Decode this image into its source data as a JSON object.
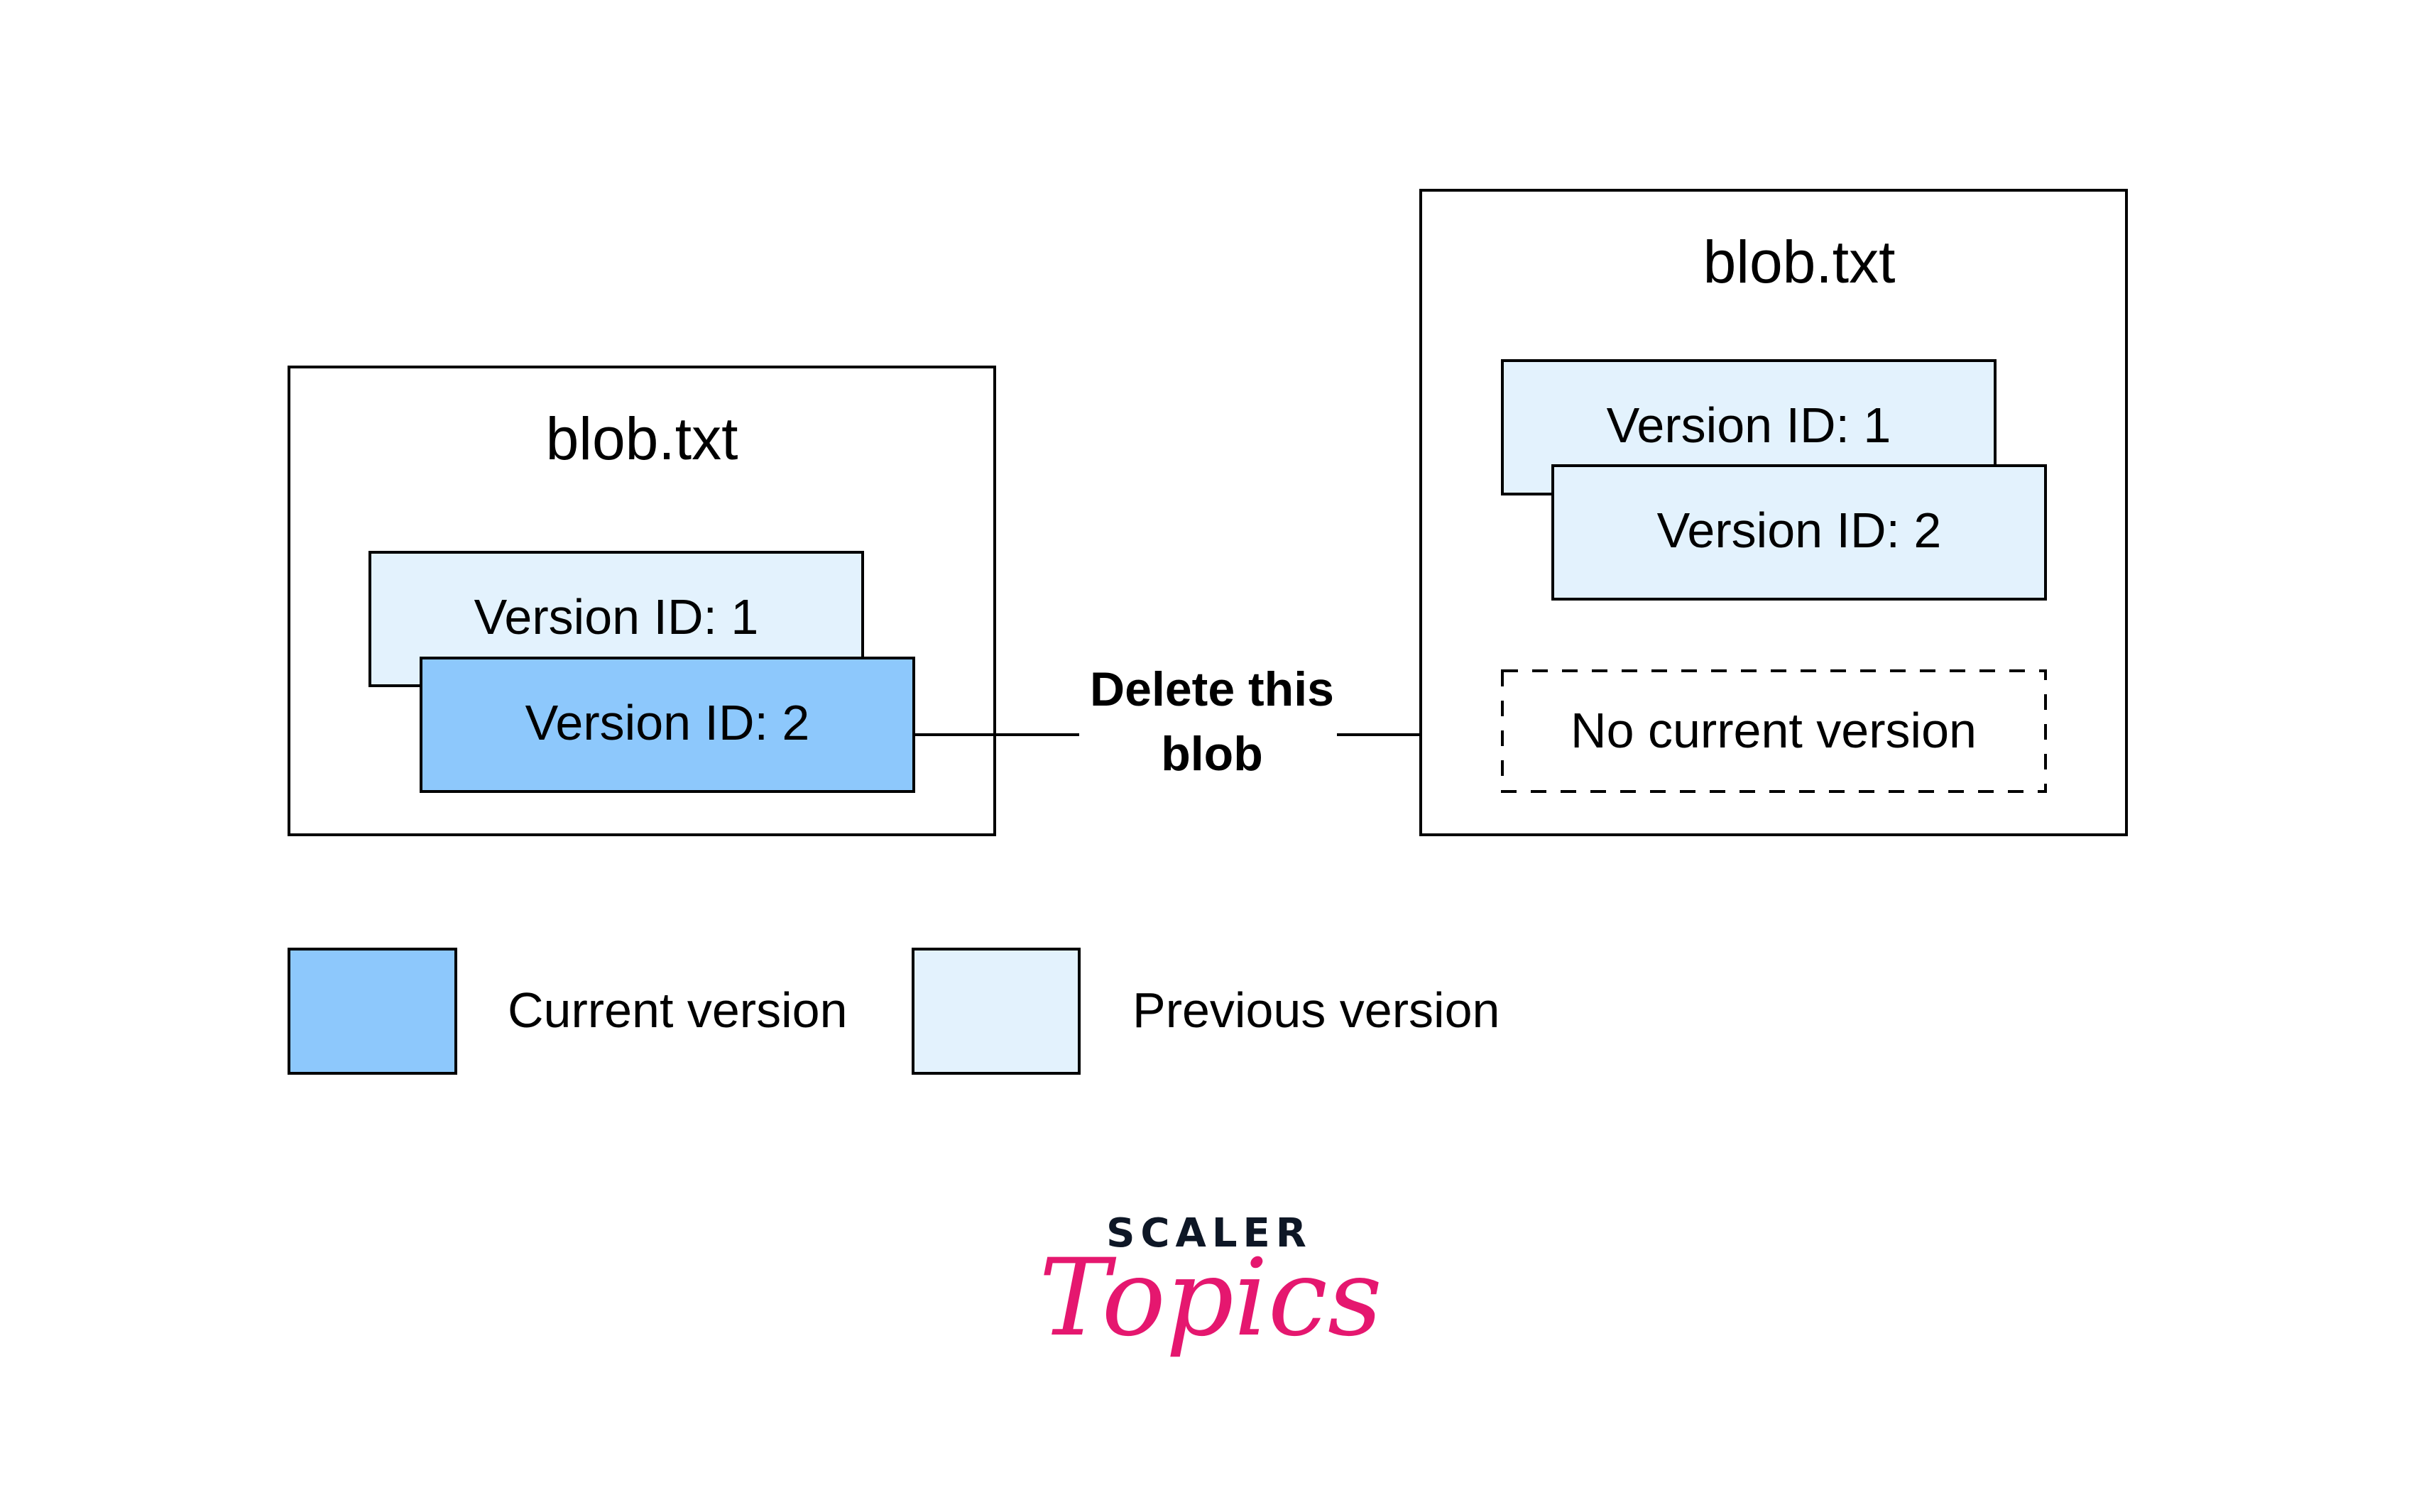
{
  "colors": {
    "current": "#8DC8FC",
    "previous": "#E3F2FD",
    "stroke": "#000000",
    "logo_dark": "#0E1726",
    "logo_pink": "#E5176F"
  },
  "before": {
    "title": "blob.txt",
    "versions": [
      {
        "label": "Version ID: 1",
        "state": "previous"
      },
      {
        "label": "Version ID: 2",
        "state": "current"
      }
    ]
  },
  "action": {
    "line1": "Delete this",
    "line2": "blob"
  },
  "after": {
    "title": "blob.txt",
    "versions": [
      {
        "label": "Version ID: 1",
        "state": "previous"
      },
      {
        "label": "Version ID: 2",
        "state": "previous"
      }
    ],
    "placeholder": "No current version"
  },
  "legend": [
    {
      "label": "Current version",
      "state": "current"
    },
    {
      "label": "Previous version",
      "state": "previous"
    }
  ],
  "logo": {
    "top": "SCALER",
    "bottom": "Topics"
  }
}
